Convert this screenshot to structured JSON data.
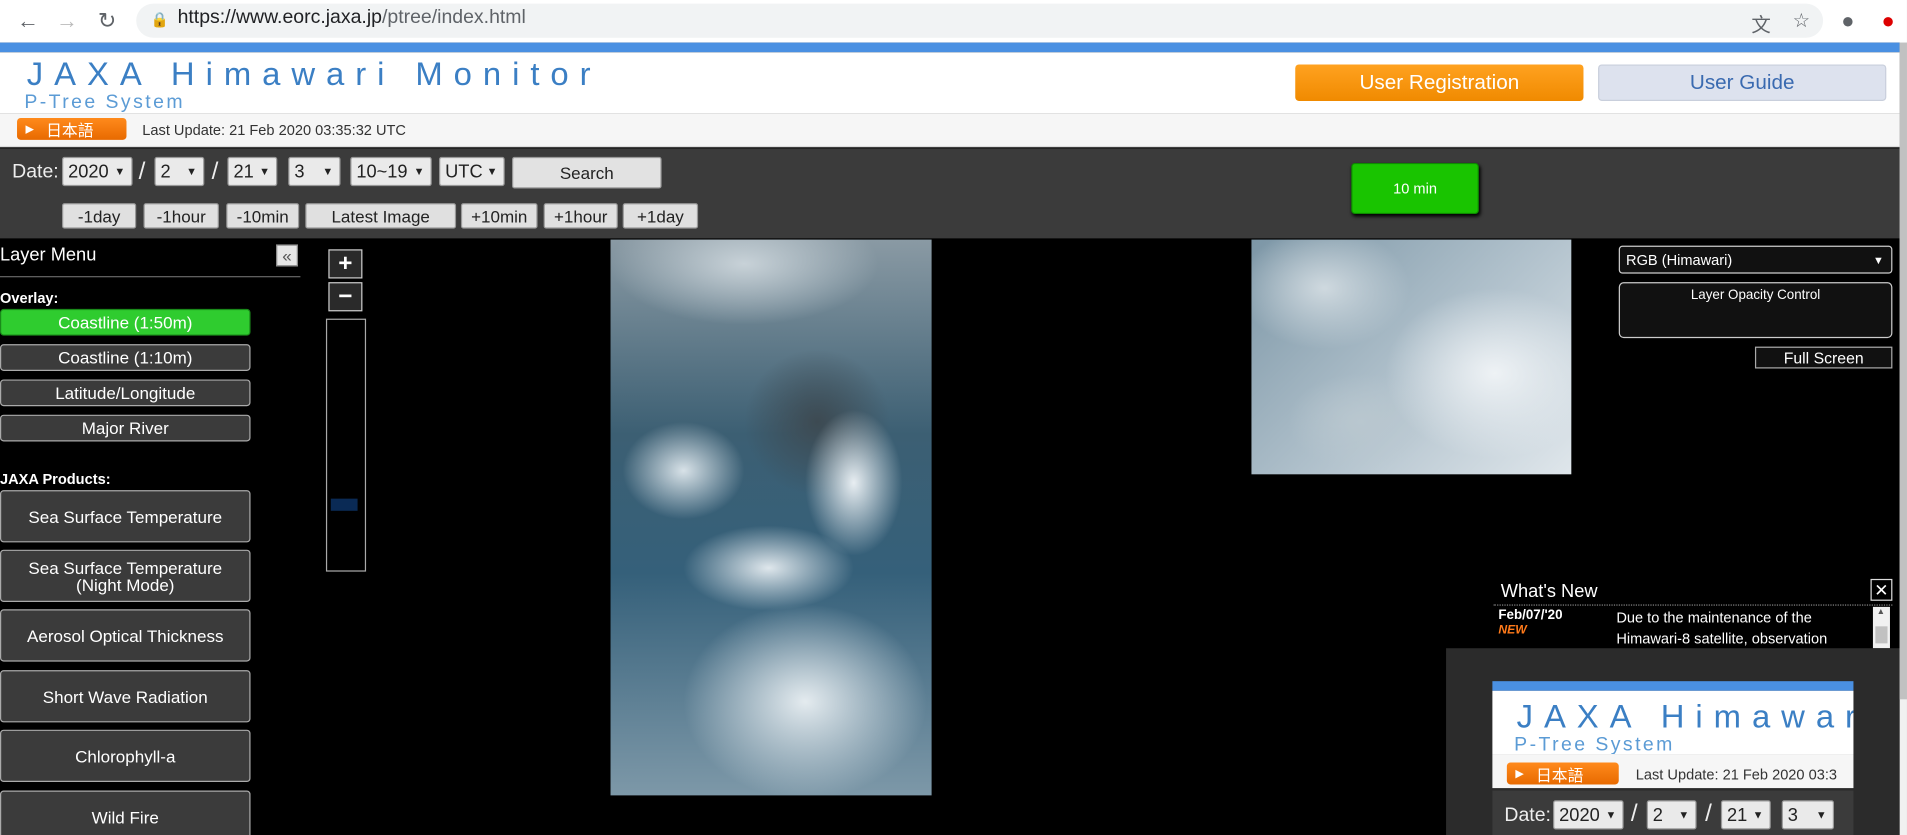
{
  "browser": {
    "url_host": "https://www.eorc.jaxa.jp",
    "url_path": "/ptree/index.html"
  },
  "header": {
    "title": "JAXA Himawari Monitor",
    "subtitle": "P-Tree System",
    "user_registration": "User Registration",
    "user_guide": "User Guide",
    "lang_button": "日本語",
    "last_update": "Last Update: 21 Feb 2020 03:35:32 UTC"
  },
  "controls": {
    "date_label": "Date:",
    "year": "2020",
    "month": "2",
    "day": "21",
    "hour": "3",
    "minute": "10~19",
    "timezone": "UTC",
    "slash": "/",
    "search": "Search",
    "interval": "10 min",
    "step": {
      "minus_day": "-1day",
      "minus_hour": "-1hour",
      "minus_10min": "-10min",
      "latest": "Latest Image",
      "plus_10min": "+10min",
      "plus_hour": "+1hour",
      "plus_day": "+1day"
    }
  },
  "layer_menu": {
    "title": "Layer Menu",
    "overlay_label": "Overlay:",
    "overlays": [
      "Coastline (1:50m)",
      "Coastline (1:10m)",
      "Latitude/Longitude",
      "Major River"
    ],
    "products_label": "JAXA Products:",
    "products": [
      "Sea Surface Temperature",
      "Sea Surface Temperature\n(Night Mode)",
      "Aerosol Optical Thickness",
      "Short Wave Radiation",
      "Chlorophyll-a",
      "Wild Fire"
    ]
  },
  "zoom": {
    "in": "+",
    "out": "−"
  },
  "right_panel": {
    "band": "RGB (Himawari)",
    "opacity": "Layer Opacity Control",
    "fullscreen": "Full Screen"
  },
  "whats_new": {
    "title": "What's New",
    "close": "✕",
    "date": "Feb/07/'20",
    "new": "NEW",
    "text": "Due to the maintenance of the Himawari-8 satellite, observation"
  },
  "preview": {
    "title": "JAXA Himawari",
    "subtitle": "P-Tree System",
    "lang_button": "日本語",
    "last_update": "Last Update: 21 Feb 2020 03:3",
    "date_label": "Date:",
    "year": "2020",
    "month": "2",
    "day": "21",
    "hour": "3"
  }
}
